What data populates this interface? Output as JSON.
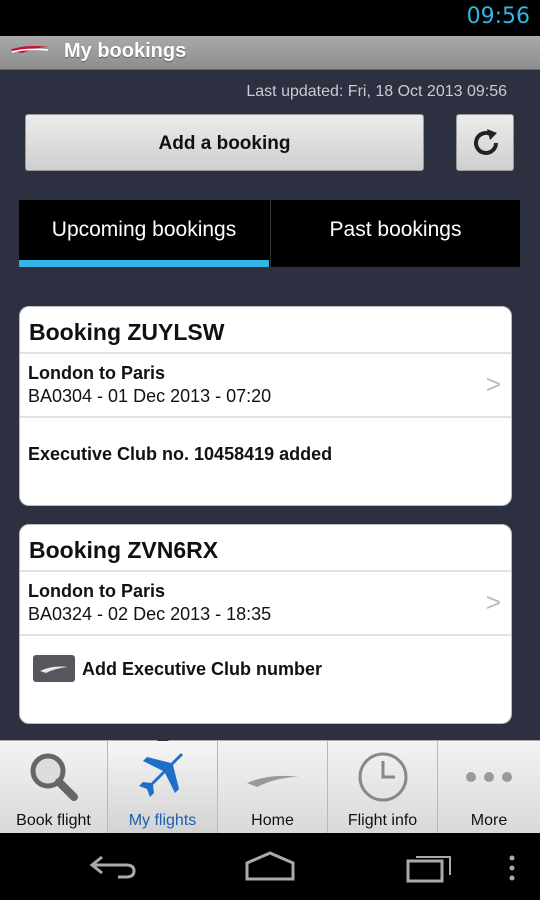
{
  "status": {
    "time": "09:56"
  },
  "header": {
    "title": "My bookings",
    "logo": "ba-speedmarque-logo"
  },
  "main": {
    "last_updated": "Last updated: Fri, 18 Oct 2013 09:56",
    "add_button_label": "Add a booking",
    "refresh_icon": "refresh-icon",
    "tabs": [
      {
        "label": "Upcoming bookings",
        "active": true
      },
      {
        "label": "Past bookings",
        "active": false
      }
    ],
    "bookings": [
      {
        "title": "Booking ZUYLSW",
        "route": "London to Paris",
        "detail": "BA0304 - 01 Dec 2013 - 07:20",
        "club": "Executive Club no. 10458419 added"
      },
      {
        "title": "Booking ZVN6RX",
        "route": "London to Paris",
        "detail": "BA0324 - 02 Dec 2013 - 18:35",
        "club": "Add Executive Club number"
      }
    ]
  },
  "bottom_nav": [
    {
      "label": "Book flight",
      "icon": "search-icon"
    },
    {
      "label": "My flights",
      "icon": "airplane-icon",
      "active": true
    },
    {
      "label": "Home",
      "icon": "ba-logo-icon"
    },
    {
      "label": "Flight info",
      "icon": "clock-icon"
    },
    {
      "label": "More",
      "icon": "more-dots-icon"
    }
  ],
  "colors": {
    "accent": "#33b5e5",
    "background": "#2d3040",
    "active_nav": "#1f5fa8"
  }
}
